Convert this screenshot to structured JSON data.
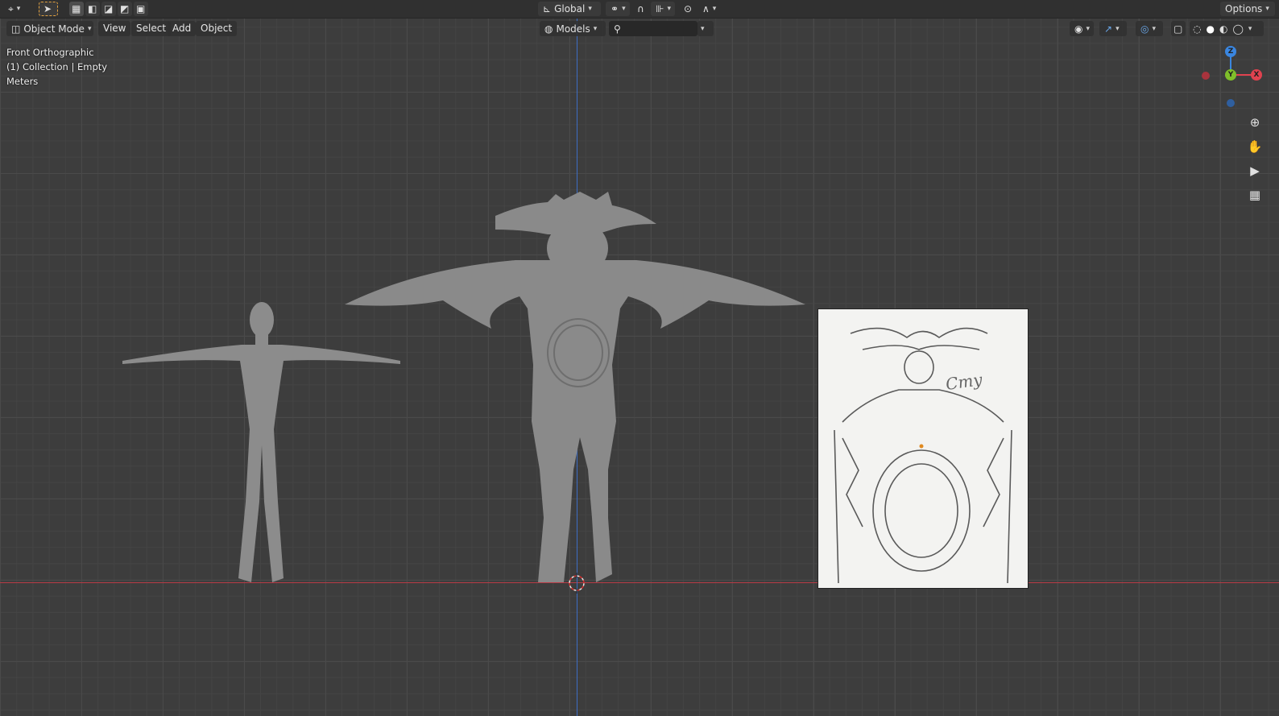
{
  "topbar": {
    "transform_orientation": "Global",
    "options_label": "Options"
  },
  "viewport_header": {
    "mode": "Object Mode",
    "menus": [
      "View",
      "Select",
      "Add",
      "Object"
    ],
    "collection_selector": "Models",
    "search_placeholder": ""
  },
  "overlay": {
    "view_name": "Front Orthographic",
    "context": "(1) Collection | Empty",
    "units": "Meters"
  },
  "gizmo": {
    "axes": [
      "Z",
      "Y",
      "X"
    ],
    "colors": {
      "x": "#e0424f",
      "y": "#7fbf2a",
      "z": "#3a86e0"
    }
  },
  "reference_image": {
    "signature": "Cmy"
  },
  "colors": {
    "background": "#3d3d3d",
    "header": "#303030",
    "x_axis_line": "#b83a45",
    "z_axis_line": "#3d6dc4",
    "mesh": "#8c8c8c"
  }
}
